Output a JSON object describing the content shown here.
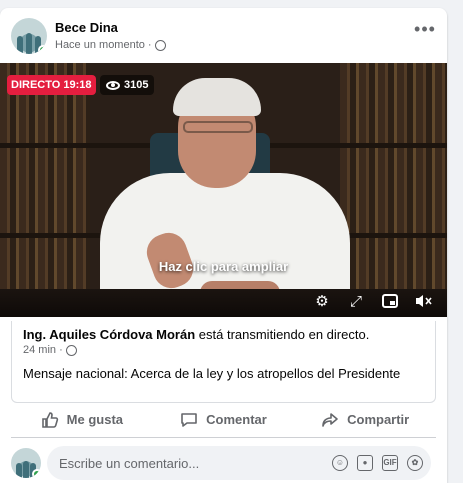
{
  "post": {
    "author": "Bece Dina",
    "timestamp": "Hace un momento ·",
    "privacy_icon": "globe-icon",
    "more_icon": "ellipsis-icon"
  },
  "video": {
    "live_badge": "DIRECTO 19:18",
    "viewer_count": "3105",
    "zoom_hint": "Haz clic para ampliar",
    "controls": [
      "settings-icon",
      "expand-icon",
      "mini-player-icon",
      "mute-icon"
    ]
  },
  "shared": {
    "page_name": "Ing. Aquiles Córdova Morán",
    "action_text": " está transmitiendo en directo.",
    "time": "24 min ·",
    "description": "Mensaje nacional: Acerca de la ley y los atropellos del Presidente"
  },
  "actions": {
    "like": "Me gusta",
    "comment": "Comentar",
    "share": "Compartir"
  },
  "composer": {
    "placeholder": "Escribe un comentario...",
    "icons": [
      "emoji-icon",
      "camera-icon",
      "gif-icon",
      "sticker-icon"
    ]
  },
  "colors": {
    "live_red": "#e41e3f",
    "online_green": "#31a24c",
    "secondary_text": "#65676b"
  }
}
